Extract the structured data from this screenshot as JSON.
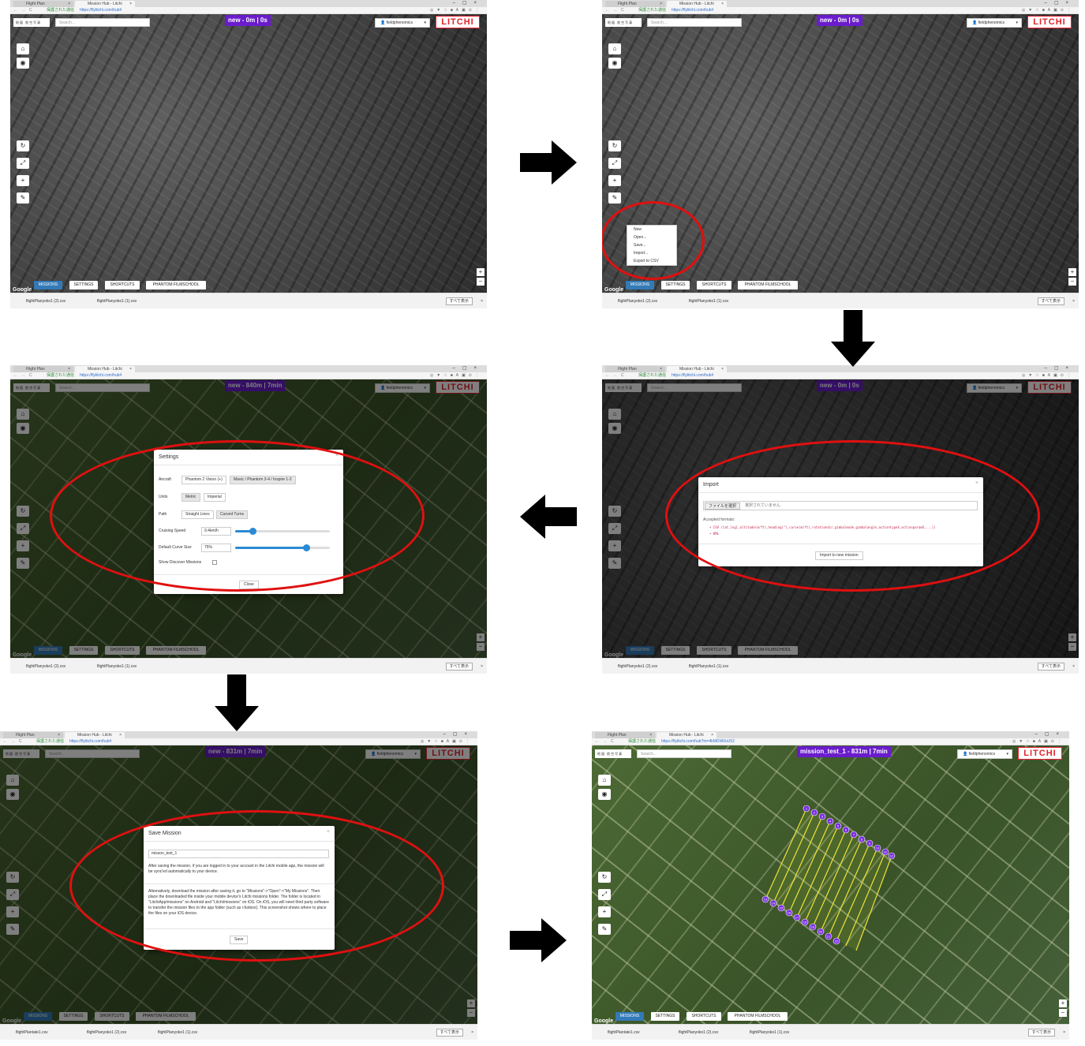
{
  "browser": {
    "tab_flight_plan": "Flight Plan",
    "tab_mission_hub": "Mission Hub - Litchi",
    "secure_label": "保護された通信",
    "url": "https://flylitchi.com/hub#",
    "url_final": "https://flylitchi.com/hub?m=4kMDW0oU52",
    "window_label": "旧姓"
  },
  "map": {
    "map_type_label": "地図 航空写真",
    "search_placeholder": "Search...",
    "user_label": "fieldphenomics",
    "logo_text": "LITCHI",
    "google_label": "Google",
    "zoom_in": "+",
    "zoom_out": "−"
  },
  "bottom_buttons": [
    "MISSIONS",
    "SETTINGS",
    "SHORTCUTS",
    "PHANTOM FILMSCHOOL"
  ],
  "downloads": {
    "file1": "flightPlanyoko1 (2).csv",
    "file2": "flightPlanyoko1 (1).csv",
    "file3": "flightPlantate1.csv",
    "show_all": "すべて表示"
  },
  "panels": [
    {
      "title": "new - 0m | 0s"
    },
    {
      "title": "new - 0m | 0s"
    },
    {
      "title": "new - 840m | 7min"
    },
    {
      "title": "new - 0m | 0s"
    },
    {
      "title": "new - 831m | 7min"
    },
    {
      "title": "mission_test_1 - 831m | 7min"
    }
  ],
  "missions_menu": [
    "New",
    "Open...",
    "Save...",
    "Import...",
    "Export to CSV"
  ],
  "settings_modal": {
    "title": "Settings",
    "aircraft_label": "Aircraft",
    "aircraft_options": [
      "Phantom 2 Vision (+)",
      "Mavic / Phantom 3-4 / Inspire 1-2"
    ],
    "units_label": "Units",
    "units_options": [
      "Metric",
      "Imperial"
    ],
    "path_label": "Path",
    "path_options": [
      "Straight Lines",
      "Curved Turns"
    ],
    "speed_label": "Cruising Speed",
    "speed_value": "9.4km/h",
    "speed_level": 0.18,
    "curve_label": "Default Curve Size",
    "curve_value": "75%",
    "curve_level": 0.75,
    "discover_label": "Show Discover Missions",
    "close_label": "Close"
  },
  "import_modal": {
    "title": "Import",
    "file_button": "ファイルを選択",
    "file_status": "選択されていません",
    "accepted_label": "Accepted formats:",
    "format_csv": "CSV (lat,lng[,altitude(m/ft),heading(°),curve(m/ft),rotationdir,gimbalmode,gimbalangle,actiontypeX,actionparamX,...])",
    "format_kml": "KML",
    "import_button": "Import to new mission"
  },
  "save_modal": {
    "title": "Save Mission",
    "name_value": "misson_test_1",
    "note1": "After saving the mission, if you are logged in to your account in the Litchi mobile app, the mission will be sync'ed automatically to your device.",
    "note2": "Alternatively, download the mission after saving it, go to \"Missions\"->\"Open\"->\"My Missions\". Then place the downloaded file inside your mobile device's Litchi missions folder. The folder is located in \"LitchiApp/missions\" on Android and \"Litchi/missions\" on iOS. On iOS, you will need third party software to transfer the mission files to the app folder (such as i-funbox). This screenshot shows where to place the files on your iOS device.",
    "save_button": "Save"
  },
  "waypoints_top": [
    "1",
    "2",
    "3",
    "4",
    "5",
    "6",
    "7",
    "8",
    "9",
    "10",
    "11",
    "12",
    "13",
    "14",
    "15",
    "16",
    "17",
    "18",
    "19",
    "20",
    "21",
    "22"
  ],
  "colors": {
    "accent": "#6a1ccd",
    "missions_button": "#337ab7",
    "logo": "#e2232b",
    "highlight_ring": "#e01010",
    "arrow": "#000000"
  }
}
